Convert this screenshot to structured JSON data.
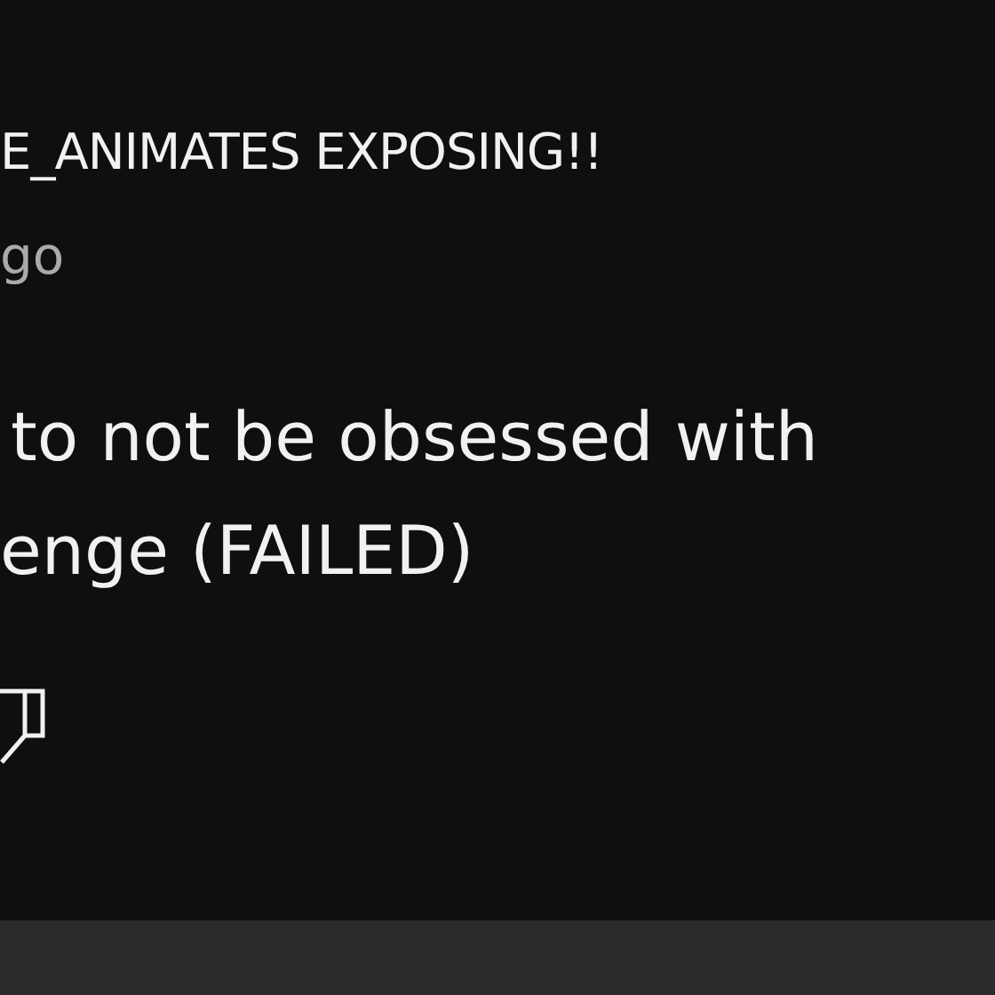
{
  "post": {
    "author": "E_ANIMATES EXPOSING!!",
    "time": "go",
    "text_lines": [
      "to not be obsessed with",
      "enge (FAILED)"
    ]
  }
}
